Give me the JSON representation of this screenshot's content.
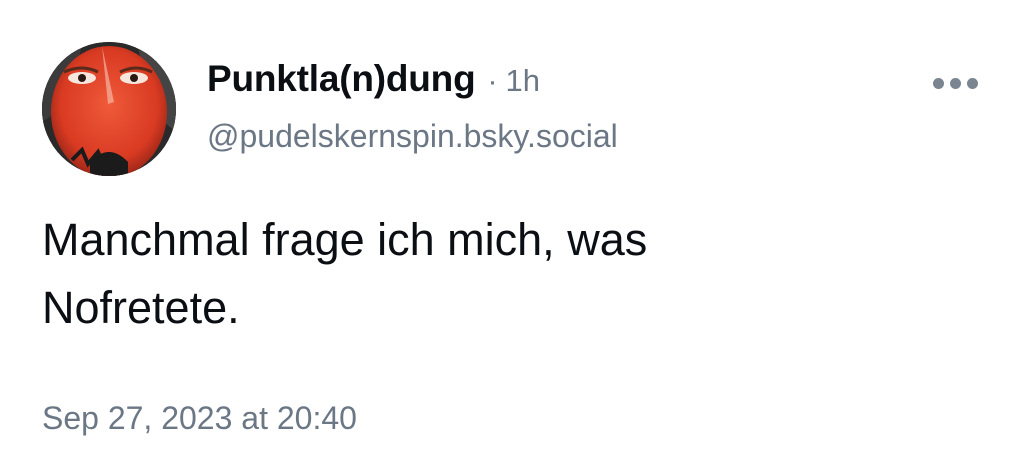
{
  "post": {
    "author": {
      "display_name": "Punktla(n)dung",
      "handle": "@pudelskernspin.bsky.social",
      "avatar_icon": "avatar-stop-war-image"
    },
    "separator": "·",
    "time_ago": "1h",
    "more_icon": "more-horizontal-icon",
    "text_lines": [
      "Manchmal frage ich mich, was",
      "Nofretete."
    ],
    "timestamp": "Sep 27, 2023 at 20:40"
  },
  "colors": {
    "text_primary": "#0b0f14",
    "text_secondary": "#6b7785",
    "background": "#ffffff",
    "avatar_accent": "#e0442a"
  }
}
